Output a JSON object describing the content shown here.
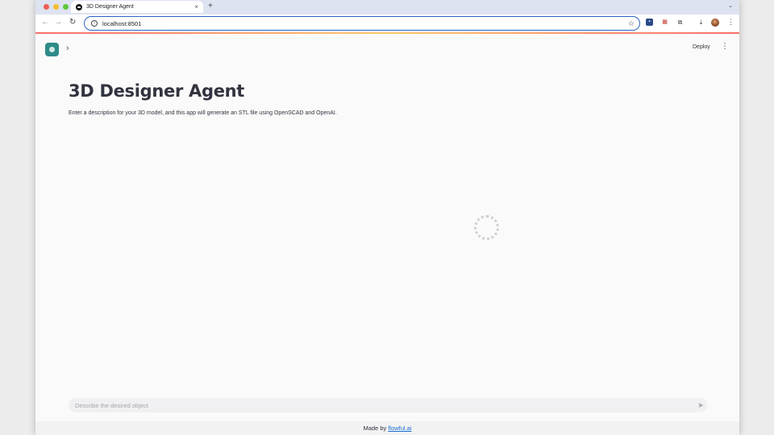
{
  "browser": {
    "tab_title": "3D Designer Agent",
    "tab_close": "×",
    "new_tab": "+",
    "url": "localhost:8501",
    "icons": [
      "back-icon",
      "forward-icon",
      "reload-icon",
      "info-icon",
      "star-icon",
      "trello-extension-icon",
      "grid-extension-icon",
      "puzzle-icon",
      "download-icon",
      "profile-avatar",
      "kebab-menu-icon"
    ]
  },
  "app": {
    "deploy_label": "Deploy",
    "title": "3D Designer Agent",
    "description": "Enter a description for your 3D model, and this app will generate an STL file using OpenSCAD and OpenAI.",
    "chat_placeholder": "Describe the desired object",
    "footer_prefix": "Made by ",
    "footer_link": "flowful.ai"
  },
  "colors": {
    "omnibox_border": "#2b63c4",
    "logo": "#2f8a88",
    "title_text": "#31333f",
    "link": "#1c6ed6"
  }
}
